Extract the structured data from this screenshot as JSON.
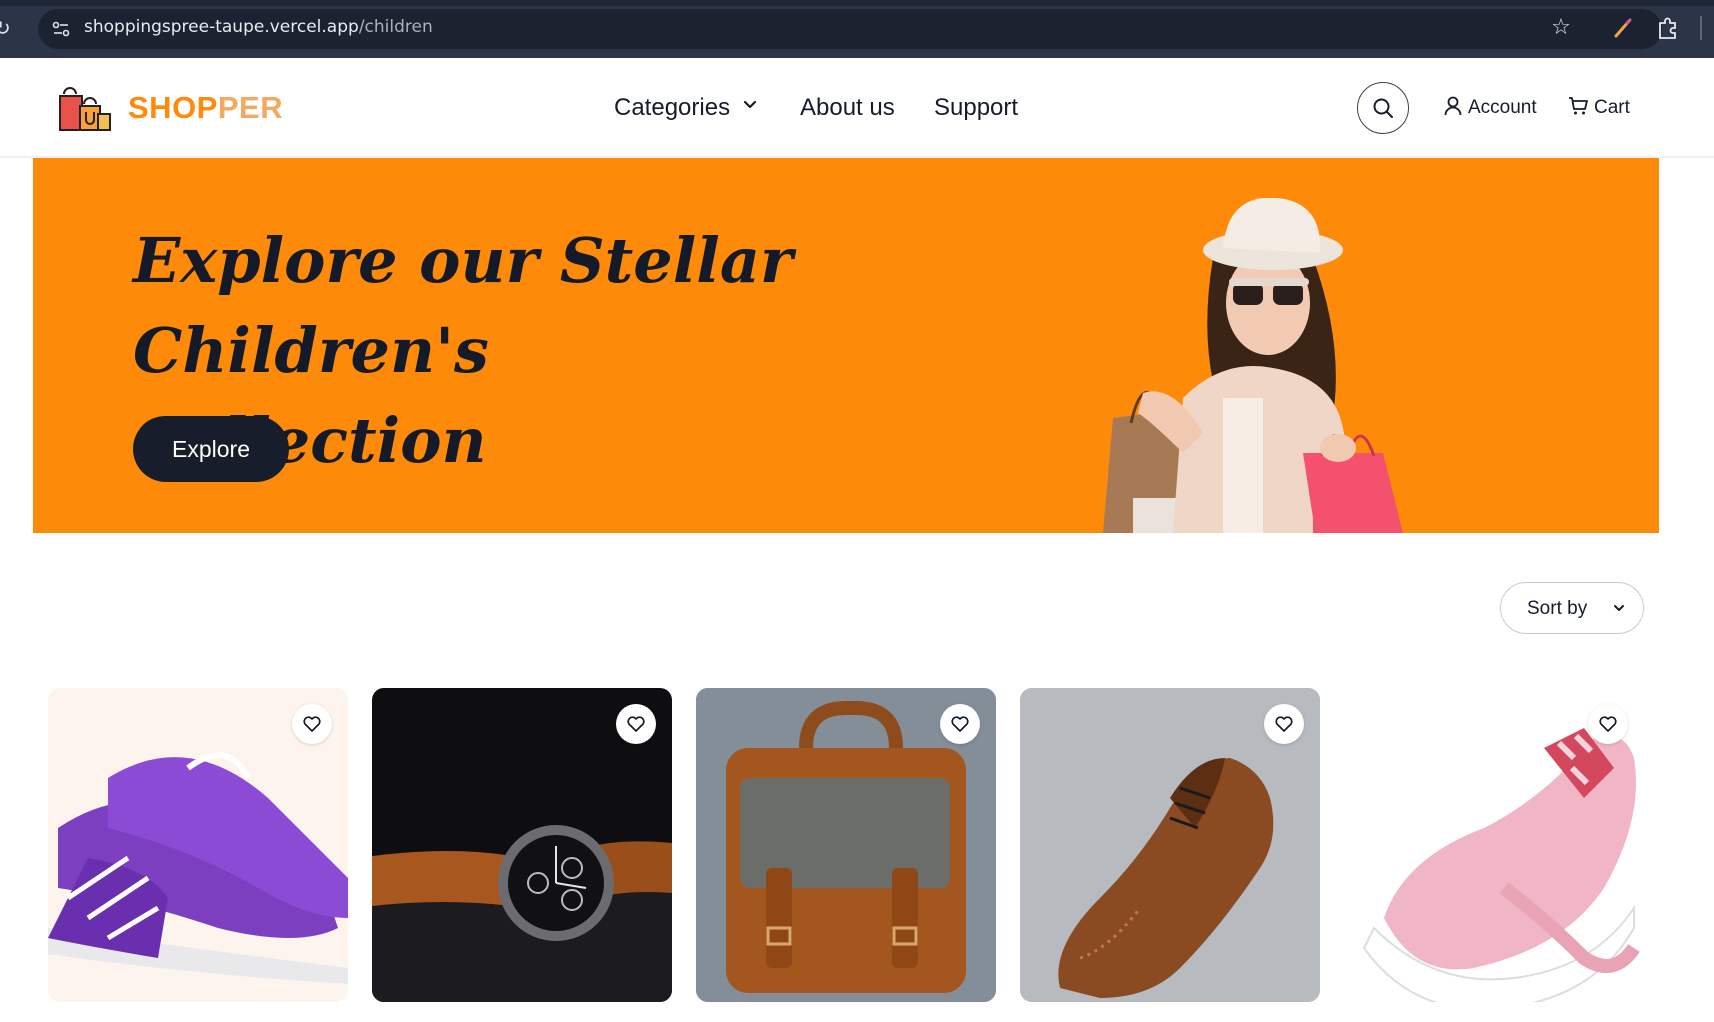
{
  "browser": {
    "url_host": "shoppingspree-taupe.vercel.app",
    "url_path": "/children"
  },
  "header": {
    "logo_part1": "SHOP",
    "logo_part2": "PER",
    "nav": {
      "categories": "Categories",
      "about": "About us",
      "support": "Support"
    },
    "account": "Account",
    "cart": "Cart"
  },
  "hero": {
    "title": "Explore our Stellar Children's Collection",
    "button": "Explore"
  },
  "sort": {
    "label": "Sort by"
  },
  "products": [
    {
      "icon": "purple-sneakers"
    },
    {
      "icon": "wrist-watch"
    },
    {
      "icon": "leather-bag"
    },
    {
      "icon": "brogue-shoe"
    },
    {
      "icon": "pink-slip-ons"
    }
  ],
  "colors": {
    "brand_orange": "#fe8a0a",
    "dark_navy": "#171d2b"
  }
}
